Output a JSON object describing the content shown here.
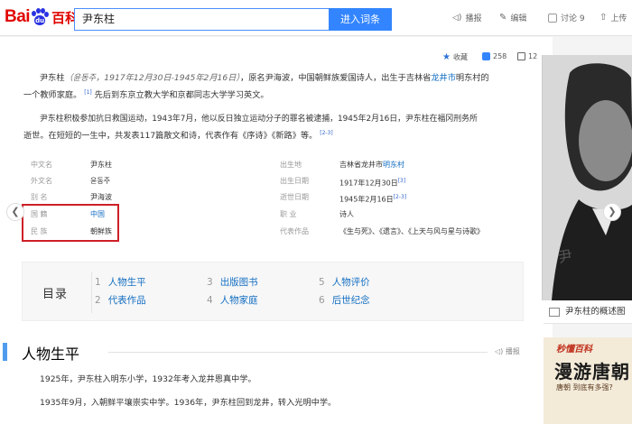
{
  "header": {
    "logo_bai": "Bai",
    "logo_du": "du",
    "logo_baike": "百科",
    "search_value": "尹东柱",
    "search_button": "进入词条",
    "nav": [
      {
        "icon": "play-icon",
        "label": "播报"
      },
      {
        "icon": "edit-icon",
        "label": "编辑"
      },
      {
        "icon": "discuss-icon",
        "label": "讨论 9"
      },
      {
        "icon": "upload-icon",
        "label": "上传"
      }
    ]
  },
  "stats": {
    "collect": "收藏",
    "likes": "258",
    "shares": "12"
  },
  "intro": {
    "p1_name": "尹东柱",
    "p1_italic": "（윤동주，1917年12月30日-1945年2月16日）",
    "p1_a": "，原名尹海波，中国朝鲜族爱国诗人，出生于吉林省",
    "p1_link": "龙井市",
    "p1_b": "明东村的",
    "p1_c": "一个教师家庭。",
    "p1_sup1": "[1]",
    "p1_d": "先后到东京立教大学和京都同志大学学习英文。",
    "p2_a": "尹东柱积极参加抗日救国运动，1943年7月，他以反日独立运动分子的罪名被逮捕，1945年2月16日，尹东柱在福冈刑务所",
    "p2_b": "逝世。在短短的一生中，共发表117篇散文和诗，代表作有《序诗》《新路》等。",
    "p2_sup": "[2-3]"
  },
  "basic_info": {
    "left": [
      {
        "key": "中文名",
        "value": "尹东柱"
      },
      {
        "key": "外文名",
        "value": "윤동주"
      },
      {
        "key": "别    名",
        "value": "尹海波"
      },
      {
        "key": "国    籍",
        "value": "中国"
      },
      {
        "key": "民    族",
        "value": "朝鲜族"
      }
    ],
    "right": [
      {
        "key": "出生地",
        "value": "吉林省龙井市",
        "link": "明东村",
        "sup": ""
      },
      {
        "key": "出生日期",
        "value": "1917年12月30日",
        "link": "",
        "sup": "[3]"
      },
      {
        "key": "逝世日期",
        "value": "1945年2月16日",
        "link": "",
        "sup": "[2-3]"
      },
      {
        "key": "职    业",
        "value": "诗人",
        "link": "",
        "sup": ""
      },
      {
        "key": "代表作品",
        "value": "《生与死》、《遗言》、《上天与风与星与诗歌》",
        "link": "",
        "sup": ""
      }
    ]
  },
  "catalog": {
    "title": "目录",
    "items": [
      {
        "num": "1",
        "label": "人物生平"
      },
      {
        "num": "2",
        "label": "代表作品"
      },
      {
        "num": "3",
        "label": "出版图书"
      },
      {
        "num": "4",
        "label": "人物家庭"
      },
      {
        "num": "5",
        "label": "人物评价"
      },
      {
        "num": "6",
        "label": "后世纪念"
      }
    ]
  },
  "section": {
    "title": "人物生平",
    "play": "播报",
    "paragraphs": [
      "1925年，尹东柱入明东小学，1932年考入龙井恩真中学。",
      "1935年9月，入朝鲜平壤崇实中学。1936年，尹东柱回到龙井，转入光明中学。"
    ]
  },
  "sidebar": {
    "caption": "尹东柱的概述图",
    "ad_line1": "秒懂百科",
    "ad_line2": "漫游唐朝",
    "ad_line3": "唐朝 到底有多强?"
  },
  "colors": {
    "brand_red": "#e10601",
    "brand_blue": "#2932e1",
    "link": "#136ec2",
    "button": "#3385ff",
    "highlight_border": "#cd1f27"
  }
}
